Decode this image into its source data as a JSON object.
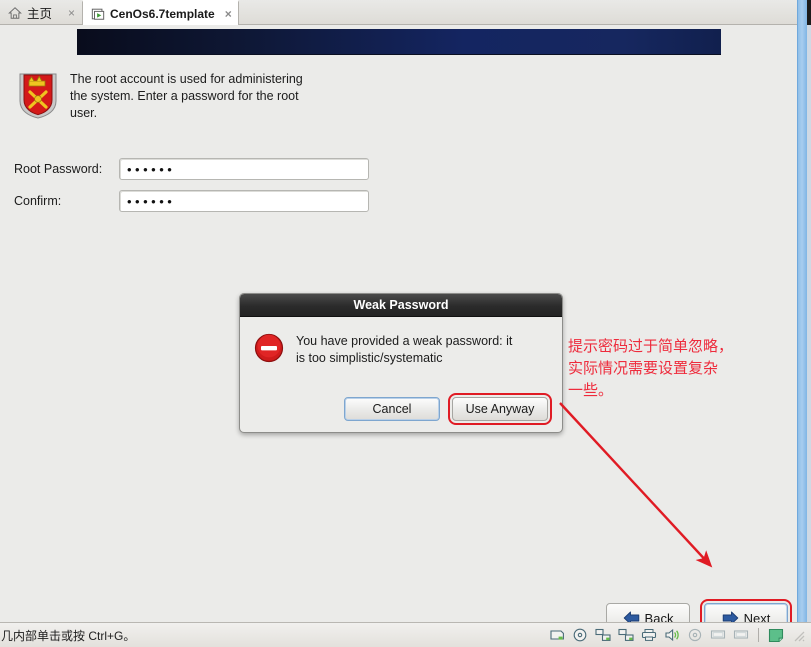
{
  "tabbar": {
    "tabs": [
      {
        "label": "主页",
        "icon": "home-icon",
        "close": "×",
        "active": false
      },
      {
        "label": "CenOs6.7template",
        "icon": "vm-icon",
        "close": "×",
        "active": true
      }
    ]
  },
  "installer": {
    "intro_text": "The root account is used for administering\nthe system.  Enter a password for the root\nuser.",
    "icon": "root-shield-icon",
    "fields": [
      {
        "label": "Root Password:",
        "value": "••••••",
        "placeholder": ""
      },
      {
        "label": "Confirm:",
        "value": "••••••",
        "placeholder": ""
      }
    ],
    "nav": {
      "back_label": "Back",
      "next_label": "Next"
    }
  },
  "modal": {
    "title": "Weak Password",
    "icon": "error-stop-icon",
    "message": "You have provided a weak password: it\nis too simplistic/systematic",
    "cancel_label": "Cancel",
    "use_anyway_label": "Use Anyway"
  },
  "annotation": {
    "text": "提示密码过于简单忽略，\n实际情况需要设置复杂\n一些。",
    "color": "#ee2b3c"
  },
  "statusbar": {
    "text": "几内部单击或按 Ctrl+G。",
    "icons": [
      "harddisk-icon",
      "cd-dvd-icon",
      "network-adapter-icon",
      "network-adapter-2-icon",
      "printer-icon",
      "sound-icon",
      "disc-icon",
      "usb-device-icon",
      "usb-device-2-icon",
      "note-icon"
    ]
  },
  "colors": {
    "accent_red": "#e01b24",
    "banner_blue": "#142561",
    "frame_blue": "#8fbfe8"
  }
}
